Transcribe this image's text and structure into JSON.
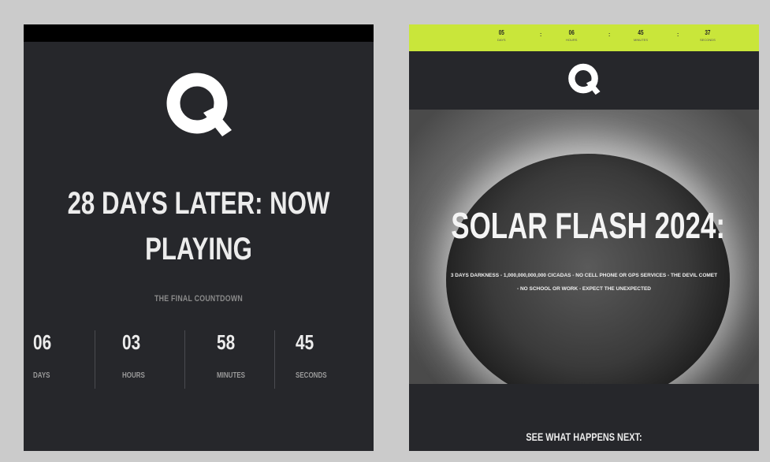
{
  "left_panel": {
    "logo_letter": "Q",
    "headline_line1": "28 DAYS LATER: NOW",
    "headline_line2": "PLAYING",
    "subtitle": "THE FINAL COUNTDOWN",
    "countdown": [
      {
        "value": "06",
        "label": "DAYS"
      },
      {
        "value": "03",
        "label": "HOURS"
      },
      {
        "value": "58",
        "label": "MINUTES"
      },
      {
        "value": "45",
        "label": "SECONDS"
      }
    ]
  },
  "right_panel": {
    "timer_bar": [
      {
        "value": "05",
        "label": "DAYS"
      },
      {
        "value": "06",
        "label": "HOURS"
      },
      {
        "value": "45",
        "label": "MINUTES"
      },
      {
        "value": "37",
        "label": "SECONDS"
      }
    ],
    "separator": ":",
    "logo_letter": "Q",
    "hero_title": "SOLAR FLASH 2024:",
    "hero_text_line1": "3 DAYS DARKNESS - 1,000,000,000,000 CICADAS - NO CELL PHONE OR GPS SERVICES - THE DEVIL COMET",
    "hero_text_line2": "- NO SCHOOL OR WORK - EXPECT THE UNEXPECTED",
    "cta": "SEE WHAT HAPPENS NEXT:"
  },
  "colors": {
    "panel_bg": "#26272b",
    "accent_lime": "#c9e63a",
    "page_bg": "#cbcbcb"
  }
}
